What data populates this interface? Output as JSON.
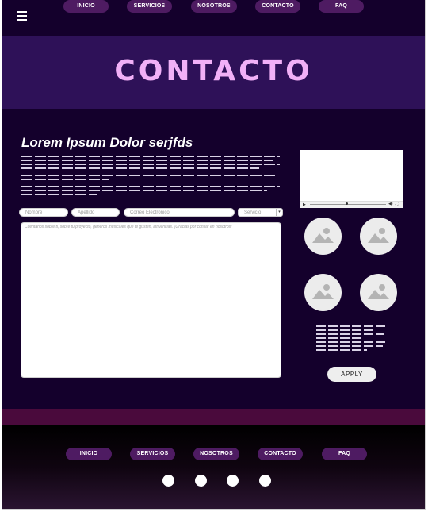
{
  "nav": {
    "items": [
      {
        "label": "INICIO"
      },
      {
        "label": "SERVICIOS"
      },
      {
        "label": "NOSOTROS"
      },
      {
        "label": "CONTACTO"
      },
      {
        "label": "FAQ"
      }
    ]
  },
  "hero": {
    "title": "CONTACTO"
  },
  "main": {
    "title": "Lorem Ipsum Dolor serjfds",
    "form": {
      "nombre_placeholder": "Nombre",
      "apellido_placeholder": "Apellido",
      "correo_placeholder": "Correo Electrónico",
      "servicio_label": "Servicio",
      "message_placeholder": "Cuéntanos sobre ti, sobre tu proyecto, géneros musicales que te gusten, influencias. ¡Gracias por confiar en nosotros!"
    },
    "apply_label": "APPLY"
  },
  "footer": {
    "items": [
      {
        "label": "INICIO"
      },
      {
        "label": "SERVICIOS"
      },
      {
        "label": "NOSOTROS"
      },
      {
        "label": "CONTACTO"
      },
      {
        "label": "FAQ"
      }
    ]
  },
  "icons": {
    "menu": "hamburger-icon",
    "avatar": "image-placeholder-icon",
    "social": "social-dot-icon"
  },
  "colors": {
    "background": "#14002c",
    "hero": "#2e1158",
    "title": "#f1b0f7",
    "nav_button": "#4e1b62",
    "stripe": "#4a0a3c"
  }
}
